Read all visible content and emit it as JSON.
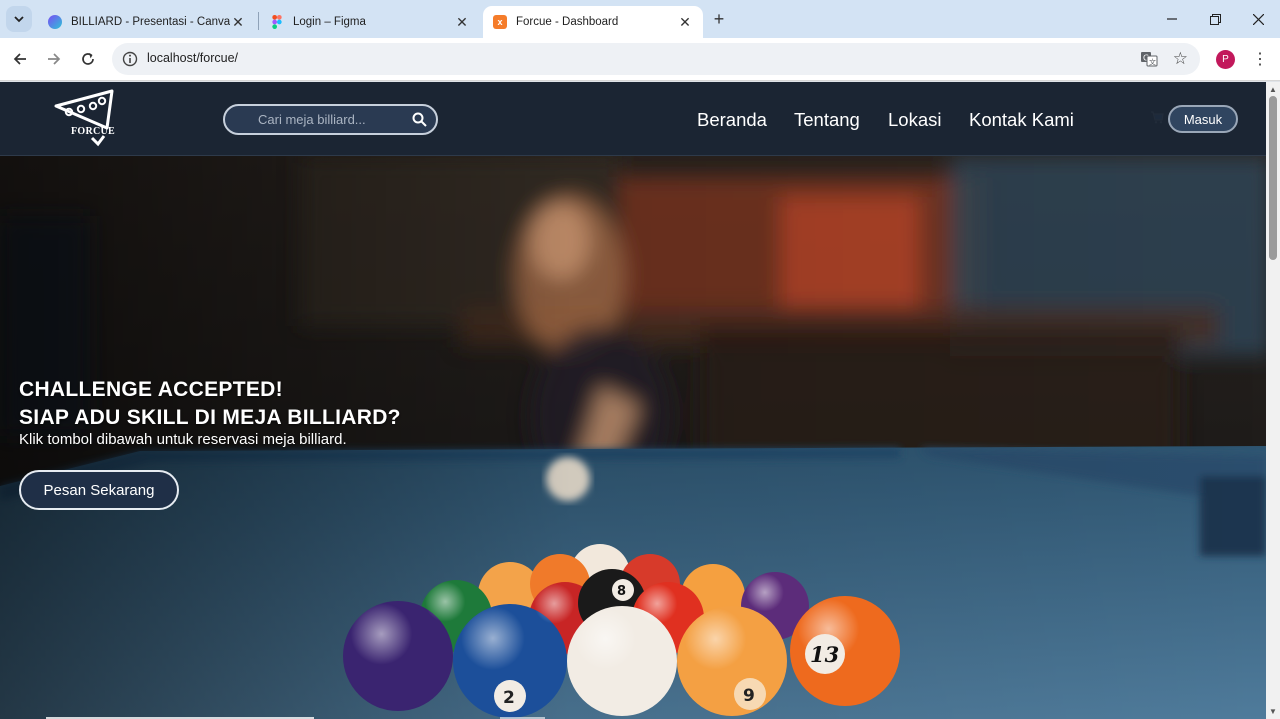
{
  "browser": {
    "tabs": [
      {
        "title": "BILLIARD - Presentasi - Canva",
        "icon": "canva-icon",
        "active": false
      },
      {
        "title": "Login – Figma",
        "icon": "figma-icon",
        "active": false
      },
      {
        "title": "Forcue - Dashboard",
        "icon": "xampp-icon",
        "active": true
      }
    ],
    "url": "localhost/forcue/",
    "profile_initial": "P"
  },
  "site": {
    "logo_text": "FORCUE",
    "search_placeholder": "Cari meja billiard...",
    "nav": [
      "Beranda",
      "Tentang",
      "Lokasi",
      "Kontak Kami"
    ],
    "login_label": "Masuk",
    "hero": {
      "headline_1": "CHALLENGE ACCEPTED!",
      "headline_2": "SIAP ADU SKILL DI MEJA BILLIARD?",
      "subtext": "Klik tombol dibawah untuk reservasi meja billiard.",
      "cta_label": "Pesan Sekarang"
    },
    "ball_numbers": [
      "8",
      "2",
      "9",
      "13"
    ]
  },
  "colors": {
    "nav_bg": "#1b2533",
    "felt": "#3f6a8a",
    "accent": "#304560"
  }
}
